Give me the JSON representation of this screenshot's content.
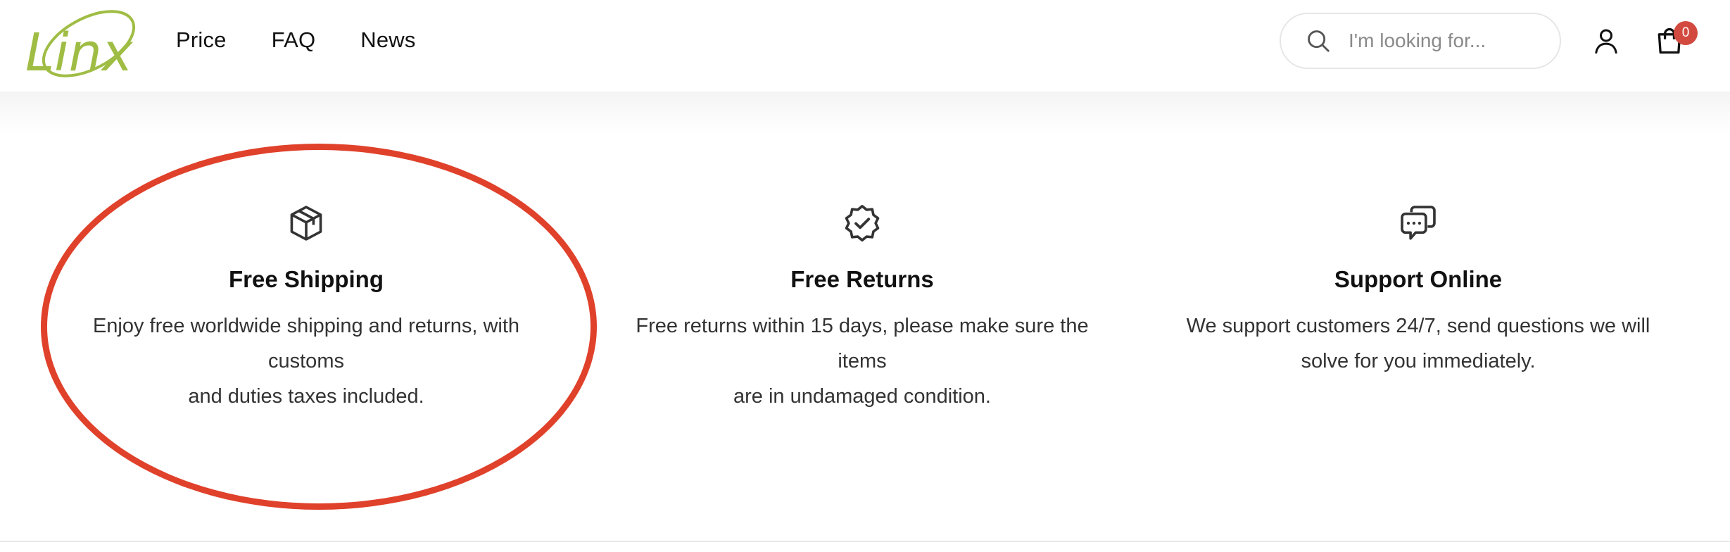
{
  "logo": {
    "text": "Linx",
    "color": "#9fbd44"
  },
  "nav": {
    "items": [
      {
        "label": "Price"
      },
      {
        "label": "FAQ"
      },
      {
        "label": "News"
      }
    ]
  },
  "search": {
    "placeholder": "I'm looking for...",
    "icon": "search-icon"
  },
  "header_icons": {
    "account": "user-icon",
    "cart": "shopping-bag-icon",
    "cart_count": "0",
    "badge_color": "#d24a3f"
  },
  "features": [
    {
      "icon": "package-box-icon",
      "title": "Free Shipping",
      "lines": [
        "Enjoy free worldwide shipping and returns, with",
        "customs",
        "and duties taxes included."
      ]
    },
    {
      "icon": "verified-badge-check-icon",
      "title": "Free Returns",
      "lines": [
        "Free returns within 15 days, please make sure the",
        "items",
        "are in undamaged condition."
      ]
    },
    {
      "icon": "chat-bubbles-icon",
      "title": "Support Online",
      "lines": [
        "We support customers 24/7, send questions we will",
        "solve for you immediately."
      ]
    }
  ],
  "annotation": {
    "type": "oval-highlight",
    "color": "#e0412b",
    "target": "Free Shipping"
  }
}
